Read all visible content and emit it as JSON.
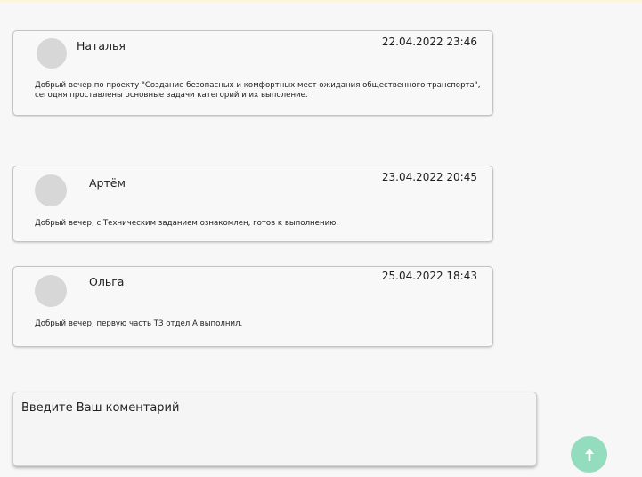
{
  "comments": [
    {
      "author": "Наталья",
      "date": "22.04.2022 23:46",
      "text": "Добрый вечер.по проекту \"Создание безопасных и комфортных мест ожидания общественного транспорта\", сегодня проставлены основные задачи категорий и их выполение."
    },
    {
      "author": "Артём",
      "date": "23.04.2022 20:45",
      "text": "Добрый вечер, с Техническим заданием ознакомлен, готов к выполнению."
    },
    {
      "author": "Ольга",
      "date": "25.04.2022 18:43",
      "text": "Добрый вечер, первую часть ТЗ отдел А выполнил."
    }
  ],
  "comment_form": {
    "placeholder": "Введите Ваш коментарий",
    "send_icon": "arrow-up-icon",
    "send_button_color": "#93dcbd"
  }
}
